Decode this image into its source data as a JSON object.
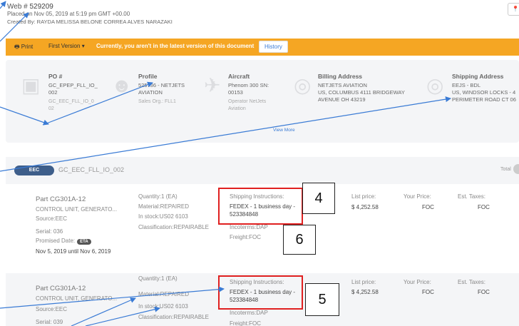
{
  "header": {
    "web_label": "Web # ",
    "web_number": "529209",
    "placed": "Placed on Nov 05, 2019 at 5:19 pm GMT +00.00",
    "created_by": "Created By: RAYDA MELISSA BELONE CORREA ALVES NARAZAKI",
    "corner_icon": "location-pin-icon"
  },
  "toolbar": {
    "print_label": "Print",
    "version_label": "First Version",
    "warning": "Currently, you aren't in the latest version of this document",
    "history_label": "History",
    "color": "#f5a623"
  },
  "info": {
    "po": {
      "label": "PO #",
      "lines": [
        "GC_EPEP_FLL_IO_",
        "002"
      ],
      "sub": [
        "GC_EEC_FLL_IO_0",
        "02"
      ]
    },
    "profile": {
      "label": "Profile",
      "lines": [
        "525736 - NETJETS",
        "AVIATION"
      ],
      "sub": [
        "Sales Org.: FLL1"
      ]
    },
    "aircraft": {
      "label": "Aircraft",
      "lines": [
        "Phenom 300 SN:",
        "00153"
      ],
      "sub": [
        "Operator NetJets",
        "Aviation"
      ]
    },
    "billing": {
      "label": "Billing Address",
      "lines": [
        "NETJETS AVIATION",
        "US, COLUMBUS 4111 BRIDGEWAY",
        "AVENUE OH 43219"
      ]
    },
    "shipping": {
      "label": "Shipping Address",
      "lines": [
        "EEJS - BDL",
        "US, WINDSOR LOCKS - 4",
        "PERIMETER ROAD CT 06"
      ]
    },
    "view_more": "View More"
  },
  "order": {
    "badge": "EEC",
    "name": "GC_EEC_FLL_IO_002",
    "total_label": "Total"
  },
  "items": [
    {
      "part": "Part CG301A-12",
      "desc": "CONTROL UNIT, GENERATO...",
      "source": "Source:EEC",
      "serial": "Serial: 036",
      "promised": "Promised Date:",
      "eta": "ETA",
      "dates": "Nov 5, 2019 until Nov 6, 2019",
      "quantity": "Quantity:1 (EA)",
      "material": "Material:REPAIRED",
      "stock": "In stock:US02 6103",
      "classification": "Classification:REPAIRABLE",
      "ship_label": "Shipping Instructions:",
      "ship_val_1": "FEDEX - 1 business day -",
      "ship_val_2": "523384848",
      "incoterms": "Incoterms:DAP",
      "freight": "Freight:FOC",
      "list_label": "List price:",
      "list_val": "$ 4,252.58",
      "your_label": "Your Price:",
      "your_val": "FOC",
      "tax_label": "Est. Taxes:",
      "tax_val": "FOC"
    },
    {
      "part": "Part CG301A-12",
      "desc": "CONTROL UNIT, GENERATO...",
      "source": "Source:EEC",
      "serial": "Serial: 039",
      "quantity": "Quantity:1 (EA)",
      "material": "Material:REPAIRED",
      "stock": "In stock:US02 6103",
      "classification": "Classification:REPAIRABLE",
      "ship_label": "Shipping Instructions:",
      "ship_val_1": "FEDEX - 1 business day -",
      "ship_val_2": "523384848",
      "incoterms": "Incoterms:DAP",
      "freight": "Freight:FOC",
      "list_label": "List price:",
      "list_val": "$ 4,252.58",
      "your_label": "Your Price:",
      "your_val": "FOC",
      "tax_label": "Est. Taxes:",
      "tax_val": "FOC"
    }
  ],
  "annotations": {
    "num_4": "4",
    "num_5": "5",
    "num_6": "6",
    "box_color": "#e02020",
    "arrow_color": "#3a7bd5"
  }
}
